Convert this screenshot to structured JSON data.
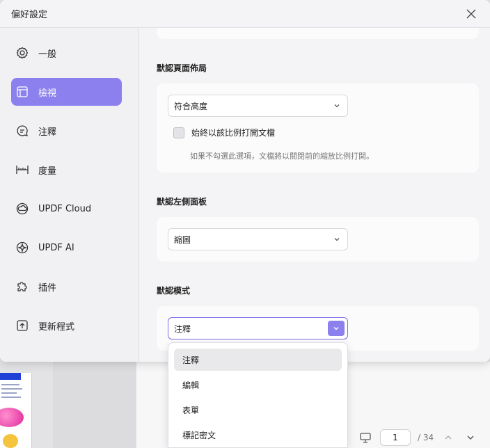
{
  "dialog": {
    "title": "偏好設定",
    "close_icon": "close-icon"
  },
  "sidebar": {
    "items": [
      {
        "label": "一般",
        "icon": "gear-icon",
        "active": false
      },
      {
        "label": "檢視",
        "icon": "layout-icon",
        "active": true
      },
      {
        "label": "注釋",
        "icon": "comment-icon",
        "active": false
      },
      {
        "label": "度量",
        "icon": "ruler-icon",
        "active": false
      },
      {
        "label": "UPDF Cloud",
        "icon": "cloud-icon",
        "active": false
      },
      {
        "label": "UPDF AI",
        "icon": "ai-sparkle-icon",
        "active": false
      },
      {
        "label": "插件",
        "icon": "puzzle-icon",
        "active": false
      },
      {
        "label": "更新程式",
        "icon": "update-icon",
        "active": false
      }
    ],
    "accent": "#8c80ee"
  },
  "content": {
    "page_layout": {
      "heading": "默認頁面佈局",
      "select_value": "符合高度",
      "checkbox_label": "始終以該比例打開文檔",
      "checkbox_checked": false,
      "hint": "如果不勾選此選項，文檔將以關閉前的縮放比例打開。"
    },
    "left_panel": {
      "heading": "默認左側面板",
      "select_value": "縮圖"
    },
    "mode": {
      "heading": "默認模式",
      "select_value": "注釋",
      "options": [
        "注釋",
        "編輯",
        "表單",
        "標記密文"
      ]
    }
  },
  "background_toolbar": {
    "current_page": "1",
    "total_pages": "/ 34"
  }
}
